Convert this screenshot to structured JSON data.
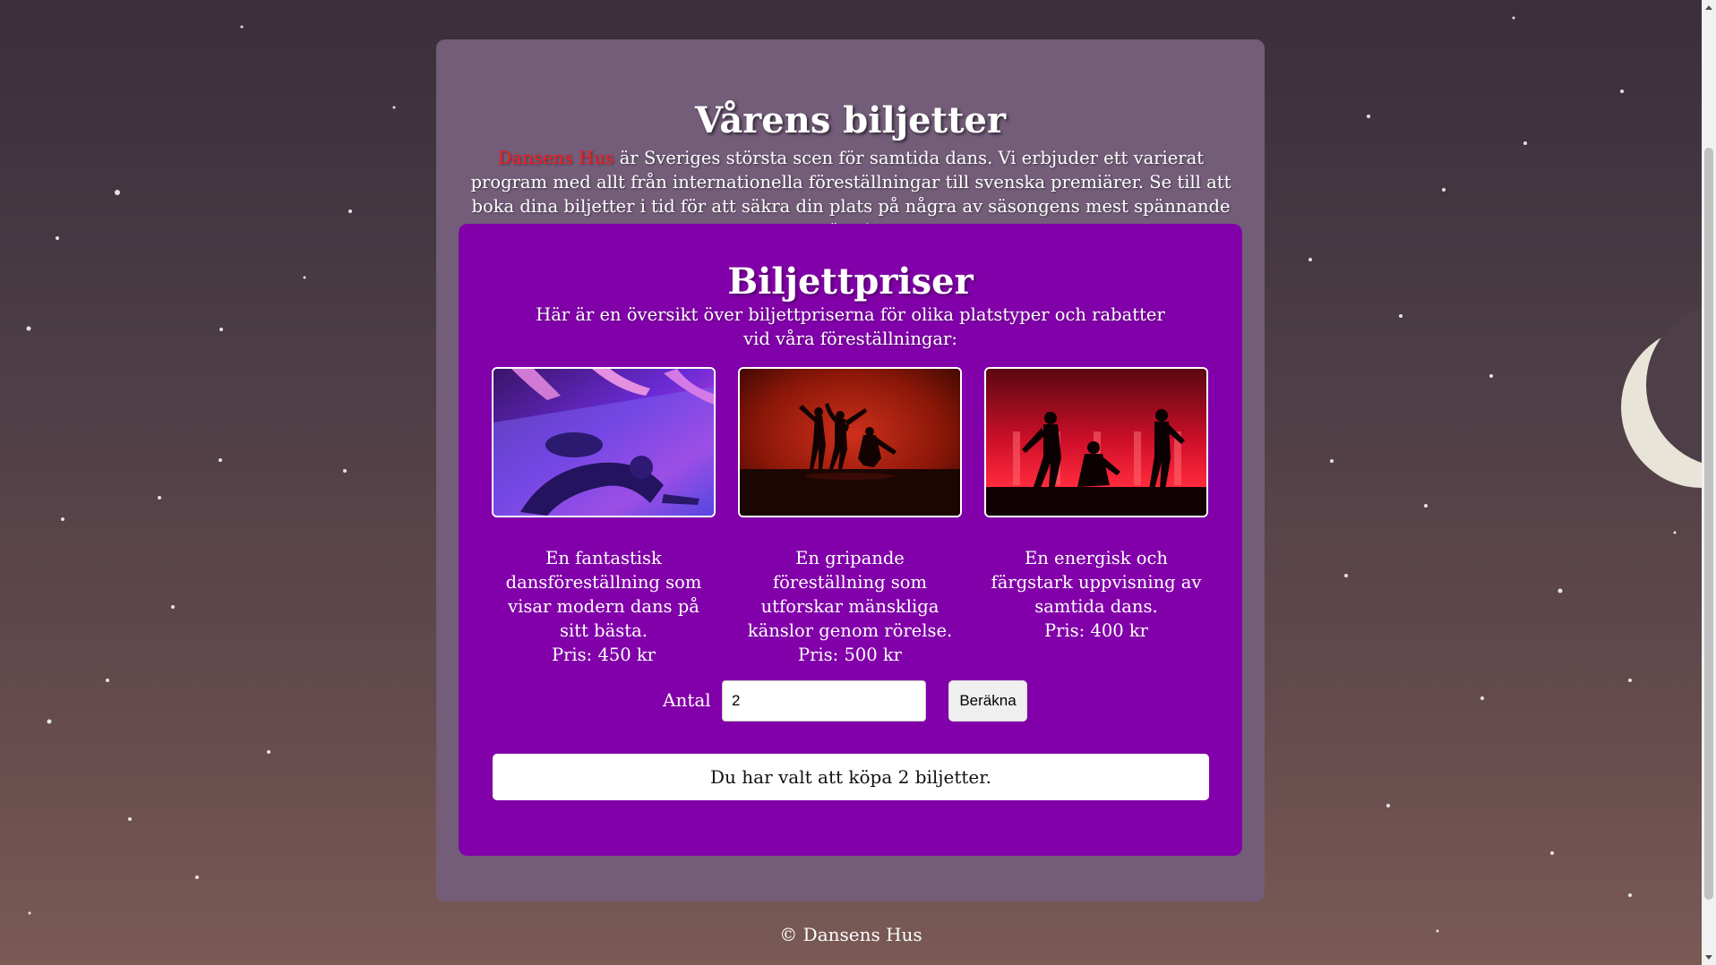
{
  "page": {
    "title": "Vårens biljetter",
    "brand": "Dansens Hus",
    "intro_rest": " är Sveriges största scen för samtida dans. Vi erbjuder ett varierat program med allt från internationella föreställningar till svenska premiärer. Se till att boka dina biljetter i tid för att säkra din plats på några av säsongens mest spännande uppsättningar."
  },
  "pricing": {
    "title": "Biljettpriser",
    "description": "Här är en översikt över biljettpriserna för olika platstyper och rabatter vid våra föreställningar:",
    "cards": [
      {
        "description": "En fantastisk dansföreställning som visar modern dans på sitt bästa.",
        "price": "Pris: 450 kr",
        "image_icon": "dancers-on-floor-photo"
      },
      {
        "description": "En gripande föreställning som utforskar mänskliga känslor genom rörelse.",
        "price": "Pris: 500 kr",
        "image_icon": "dancers-silhouette-stage-photo"
      },
      {
        "description": "En energisk och färgstark uppvisning av samtida dans.",
        "price": "Pris: 400 kr",
        "image_icon": "dancers-red-light-photo"
      }
    ]
  },
  "form": {
    "quantity_label": "Antal",
    "quantity_value": "2",
    "calculate_label": "Beräkna",
    "result_text": "Du har valt att köpa 2 biljetter."
  },
  "footer": {
    "text": "© Dansens Hus"
  },
  "colors": {
    "outer_card": "#735d79",
    "inner_card": "#8200a9",
    "brand": "#ff1a1a"
  }
}
